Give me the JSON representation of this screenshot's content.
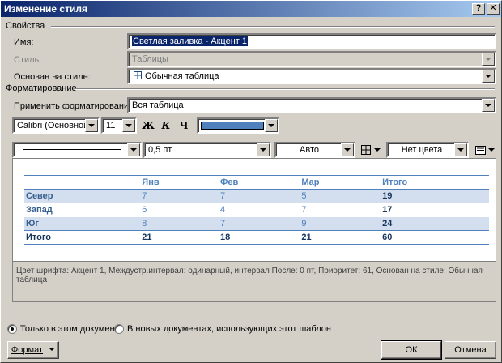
{
  "window": {
    "title": "Изменение стиля",
    "help_glyph": "?",
    "close_glyph": "✕"
  },
  "properties": {
    "group_title": "Свойства",
    "name_label": "Имя:",
    "name_value": "Светлая заливка - Акцент 1",
    "style_label": "Стиль:",
    "style_value": "Таблицы",
    "based_label": "Основан на стиле:",
    "based_value": "Обычная таблица"
  },
  "formatting": {
    "group_title": "Форматирование",
    "apply_label": "Применить форматирование к:",
    "apply_value": "Вся таблица",
    "font_value": "Calibri (Основной текс",
    "size_value": "11",
    "bold_glyph": "Ж",
    "italic_glyph": "К",
    "underline_glyph": "Ч",
    "font_color": "#4f81bd",
    "border_width": "0,5 пт",
    "border_color": "Авто",
    "shading": "Нет цвета"
  },
  "preview": {
    "headers": [
      "",
      "Янв",
      "Фев",
      "Мар",
      "Итого"
    ],
    "rows": [
      [
        "Север",
        "7",
        "7",
        "5",
        "19"
      ],
      [
        "Запад",
        "6",
        "4",
        "7",
        "17"
      ],
      [
        "Юг",
        "8",
        "7",
        "9",
        "24"
      ],
      [
        "Итого",
        "21",
        "18",
        "21",
        "60"
      ]
    ]
  },
  "description": "Цвет шрифта: Акцент 1, Междустр.интервал:  одинарный, интервал После:  0 пт, Приоритет: 61, Основан на стиле: Обычная таблица",
  "options": {
    "this_doc": "Только в этом документе",
    "new_docs": "В новых документах, использующих этот шаблон"
  },
  "buttons": {
    "format": "Формат",
    "ok": "ОК",
    "cancel": "Отмена"
  }
}
